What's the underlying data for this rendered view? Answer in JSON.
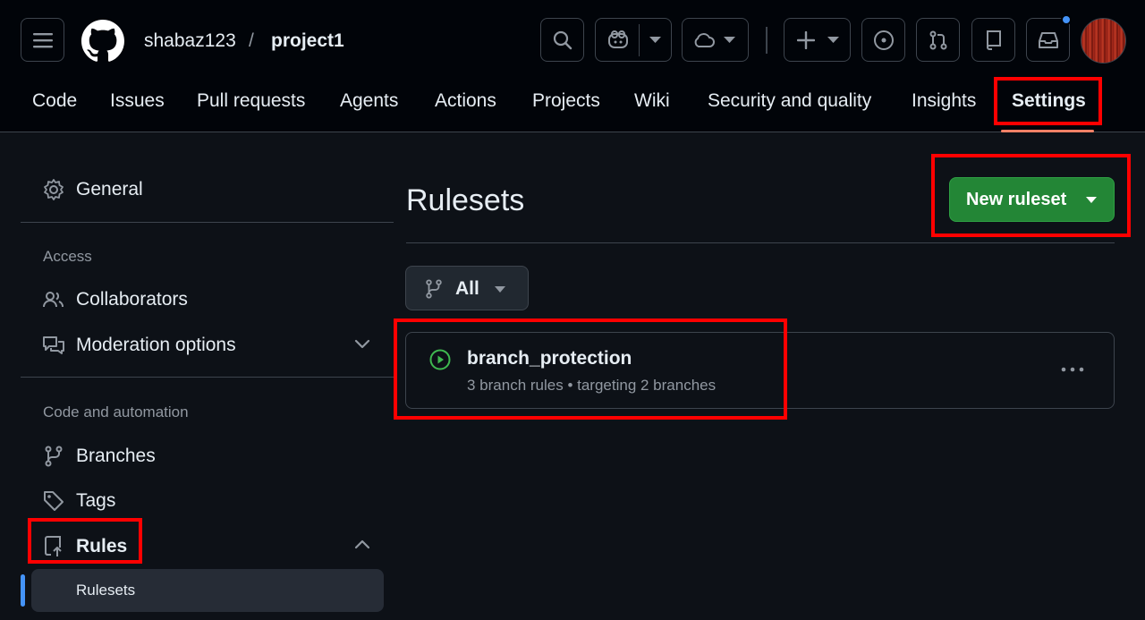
{
  "header": {
    "owner": "shabaz123",
    "separator": "/",
    "repo": "project1"
  },
  "nav": {
    "tabs": [
      {
        "label": "Code"
      },
      {
        "label": "Issues"
      },
      {
        "label": "Pull requests"
      },
      {
        "label": "Agents"
      },
      {
        "label": "Actions"
      },
      {
        "label": "Projects"
      },
      {
        "label": "Wiki"
      },
      {
        "label": "Security and quality"
      },
      {
        "label": "Insights"
      },
      {
        "label": "Settings",
        "active": true
      }
    ]
  },
  "sidebar": {
    "general": "General",
    "access_heading": "Access",
    "collaborators": "Collaborators",
    "moderation": "Moderation options",
    "code_heading": "Code and automation",
    "branches": "Branches",
    "tags": "Tags",
    "rules": "Rules",
    "rulesets": "Rulesets"
  },
  "main": {
    "title": "Rulesets",
    "new_button": "New ruleset",
    "filter_label": "All",
    "rulesets": [
      {
        "name": "branch_protection",
        "summary": "3 branch rules • targeting 2 branches",
        "status": "active"
      }
    ]
  },
  "colors": {
    "background": "#0d1117",
    "header_bg": "#010409",
    "accent_green": "#238636",
    "highlight_box": "#ff0000",
    "active_underline": "#f78166",
    "active_bar": "#4493f8"
  }
}
